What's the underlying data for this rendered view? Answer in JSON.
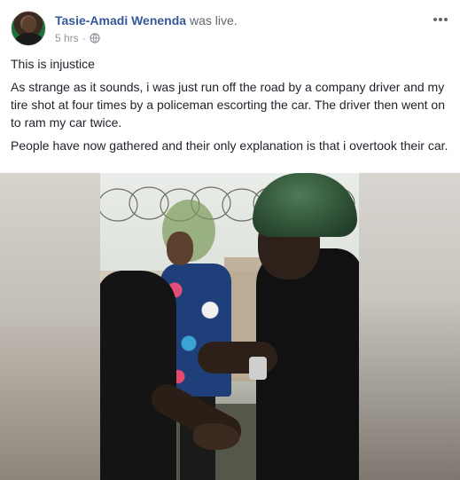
{
  "post": {
    "author": "Tasie-Amadi Wenenda",
    "action": "was live.",
    "time": "5 hrs",
    "time_separator": "·",
    "privacy_icon": "globe-icon",
    "more_icon": "more-options-icon",
    "paragraphs": [
      "This is injustice",
      "As strange as it sounds, i was just run off the road by a company driver and my tire shot at four times by a policeman escorting the car. The driver then went on to ram my car twice.",
      "People have now gathered and their only explanation is that i overtook their car."
    ]
  },
  "colors": {
    "author_link": "#365899",
    "meta_text": "#90949c",
    "body_text": "#1d2129"
  }
}
